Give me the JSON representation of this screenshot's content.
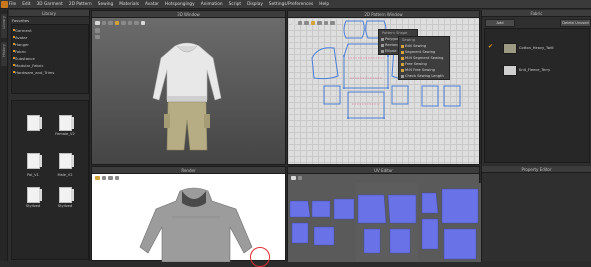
{
  "menu": {
    "items": [
      "File",
      "Edit",
      "3D Garment",
      "2D Pattern",
      "Sewing",
      "Materials",
      "Avatar",
      "Hotspongingy",
      "Animation",
      "Script",
      "Display",
      "Settings/Preferences",
      "Help"
    ]
  },
  "vertical_tabs": [
    "Library",
    "History"
  ],
  "library": {
    "title": "Library",
    "favorites_label": "Favorites",
    "tree": [
      "Garment",
      "Avatar",
      "Hanger",
      "Fabric",
      "Substance",
      "Modular_Fabric",
      "Hardware_and_Trims"
    ],
    "files": [
      "",
      "Female_V2",
      "",
      "",
      "Pol_V1",
      "Male_V2",
      "Stylized",
      "Stylized"
    ]
  },
  "window3d": {
    "title": "3D Window"
  },
  "window2d": {
    "title": "2D Pattern Window"
  },
  "context_menu": {
    "header": "Pattern Shape",
    "items": [
      "Polygon",
      "Rectangle",
      "Ellipse"
    ]
  },
  "sewing_menu": {
    "header": "Sewing",
    "items": [
      "Edit Sewing",
      "Segment Sewing",
      "M:N Segment Sewing",
      "Free Sewing",
      "M:N Free Sewing",
      "Check Sewing Length"
    ]
  },
  "fabric_panel": {
    "title": "Fabric",
    "buttons": {
      "add": "Add",
      "delete_unused": "Delete Unused"
    },
    "items": [
      {
        "name": "Cotton_Heavy_Twill",
        "color": "#9c9a83"
      },
      {
        "name": "Knit_Fleece_Terry",
        "color": "#cfcfcf"
      }
    ]
  },
  "render_window": {
    "title": "Render"
  },
  "uv_window": {
    "title": "UV Editor"
  },
  "property_editor": {
    "title": "Property Editor"
  },
  "colors": {
    "accent": "#d79a27",
    "pattern_blue": "#4a7ed6",
    "uv_blue": "#6a72e8",
    "sewing_pink": "#e0508a",
    "annotation_red": "#e03030"
  }
}
